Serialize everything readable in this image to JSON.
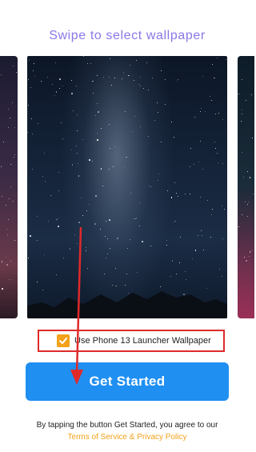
{
  "header": {
    "title": "Swipe to select wallpaper"
  },
  "wallpapers": {
    "items": [
      {
        "name": "wallpaper-left-preview"
      },
      {
        "name": "wallpaper-milky-way",
        "selected": true
      },
      {
        "name": "wallpaper-right-preview"
      }
    ]
  },
  "option": {
    "label": "Use Phone 13 Launcher Wallpaper",
    "checked": true,
    "checkbox_color": "#f4a21a",
    "highlight_color": "#e02a2a"
  },
  "cta": {
    "label": "Get Started",
    "color": "#1f8ff2"
  },
  "footer": {
    "text": "By tapping the button Get Started, you agree to our",
    "link": "Terms of Service & Privacy Policy",
    "link_color": "#f4a21a"
  },
  "annotation": {
    "arrow_color": "#e02a2a",
    "icon": "arrow-down-icon"
  },
  "colors": {
    "title": "#8b78e8"
  }
}
